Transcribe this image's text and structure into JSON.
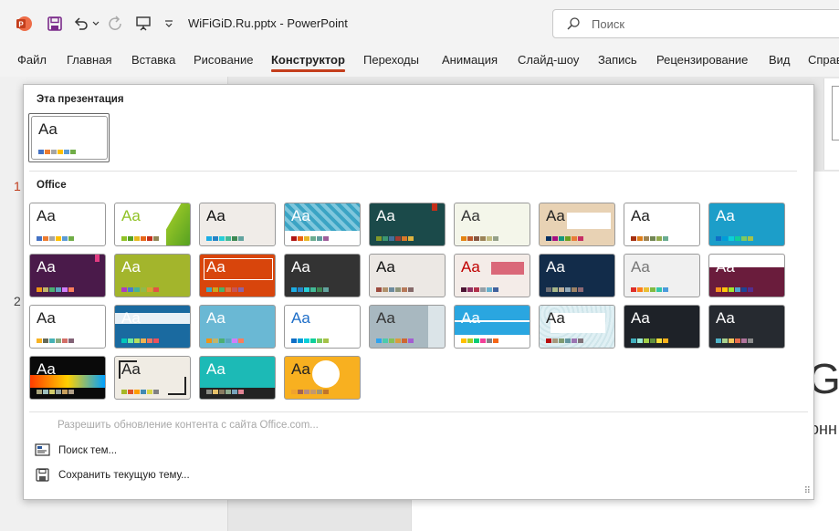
{
  "app": {
    "title": "WiFiGiD.Ru.pptx  -  PowerPoint",
    "search_placeholder": "Поиск",
    "accent": "#c43e1c"
  },
  "quick_access": {
    "icons": [
      "powerpoint-logo-icon",
      "save-icon",
      "undo-icon",
      "undo-dropdown-icon",
      "redo-icon",
      "present-icon",
      "customize-icon"
    ]
  },
  "ribbon": {
    "tabs": [
      "Файл",
      "Главная",
      "Вставка",
      "Рисование",
      "Конструктор",
      "Переходы",
      "Анимация",
      "Слайд-шоу",
      "Запись",
      "Рецензирование",
      "Вид",
      "Справ"
    ],
    "active_tab": "Конструктор"
  },
  "workspace": {
    "slide_numbers": [
      "1",
      "2"
    ],
    "main_text_1": "GiD",
    "main_text_2": "онн"
  },
  "dropdown": {
    "this_presentation_title": "Эта презентация",
    "office_title": "Office",
    "theme_sample": "Aa",
    "menu": {
      "enable_updates": "Разрешить обновление контента с сайта Office.com...",
      "browse_themes": "Поиск тем...",
      "save_theme": "Сохранить текущую тему..."
    }
  },
  "themes": [
    {
      "name": "office",
      "bg": "#ffffff",
      "fg": "#222222",
      "colors": [
        "#4472c4",
        "#ed7d31",
        "#a5a5a5",
        "#ffc000",
        "#5b9bd5",
        "#70ad47"
      ]
    },
    {
      "name": "facet",
      "bg": "#ffffff",
      "fg": "#90c226",
      "colors": [
        "#90c226",
        "#54a021",
        "#e6b91e",
        "#e76618",
        "#c42f1a",
        "#918655"
      ]
    },
    {
      "name": "integral",
      "bg": "#f0ece8",
      "fg": "#111111",
      "colors": [
        "#1cade4",
        "#2683c6",
        "#27ced7",
        "#42ba97",
        "#3e8853",
        "#62a39f"
      ]
    },
    {
      "name": "ion-boardroom",
      "bg": "#3ba4c4",
      "fg": "#ffffff",
      "colors": [
        "#b01513",
        "#ea6312",
        "#e6b729",
        "#6aac90",
        "#5f9c9d",
        "#9e5e9b"
      ]
    },
    {
      "name": "organic",
      "bg": "#1b4a4a",
      "fg": "#ffffff",
      "colors": [
        "#83992a",
        "#3c9770",
        "#44709d",
        "#a23c33",
        "#d97828",
        "#deb340"
      ]
    },
    {
      "name": "retrospect",
      "bg": "#f4f6ea",
      "fg": "#333333",
      "colors": [
        "#e48312",
        "#bd582c",
        "#865640",
        "#9b8357",
        "#c2bc80",
        "#94a088"
      ]
    },
    {
      "name": "slice",
      "bg": "#e8d2b4",
      "fg": "#222222",
      "colors": [
        "#052f61",
        "#a50e82",
        "#14967c",
        "#6a9e1f",
        "#e87d37",
        "#c62d64"
      ]
    },
    {
      "name": "wisp",
      "bg": "#ffffff",
      "fg": "#222222",
      "colors": [
        "#a53010",
        "#de7e18",
        "#9f8351",
        "#728653",
        "#92aa4c",
        "#6aac91"
      ]
    },
    {
      "name": "ion",
      "bg": "#1c9ec9",
      "fg": "#ffffff",
      "colors": [
        "#0f6fc6",
        "#009dd9",
        "#0bd0d9",
        "#10cf9b",
        "#7cca62",
        "#a5c249"
      ]
    },
    {
      "name": "berlin",
      "bg": "#4a1a4a",
      "fg": "#ffffff",
      "colors": [
        "#f09415",
        "#c1b56b",
        "#4baf73",
        "#5aa6c0",
        "#d17df9",
        "#fa7e5c"
      ]
    },
    {
      "name": "celestial",
      "bg": "#a3b52c",
      "fg": "#ffffff",
      "colors": [
        "#ac3ec1",
        "#477bd1",
        "#46b298",
        "#90ba4c",
        "#dd9d31",
        "#e25247"
      ]
    },
    {
      "name": "frame",
      "bg": "#d8450c",
      "fg": "#ffffff",
      "colors": [
        "#40a7c2",
        "#cea61b",
        "#4bb168",
        "#e2743e",
        "#c85555",
        "#8e62a3"
      ]
    },
    {
      "name": "savon",
      "bg": "#333333",
      "fg": "#ffffff",
      "colors": [
        "#1cade4",
        "#2683c6",
        "#27ced7",
        "#42ba97",
        "#3e8853",
        "#62a39f"
      ]
    },
    {
      "name": "gallery",
      "bg": "#ece8e4",
      "fg": "#111111",
      "colors": [
        "#9c4b3e",
        "#b1926c",
        "#6e8c9e",
        "#8d9479",
        "#b77a5a",
        "#866a6a"
      ]
    },
    {
      "name": "dividend",
      "bg": "#f4ece8",
      "fg": "#c00000",
      "colors": [
        "#4d1434",
        "#903163",
        "#b2324b",
        "#969fa7",
        "#66b1ce",
        "#40619d"
      ]
    },
    {
      "name": "mesh",
      "bg": "#122c4a",
      "fg": "#ffffff",
      "colors": [
        "#6f6f74",
        "#a7b789",
        "#beae98",
        "#92a9b9",
        "#9c8265",
        "#8d6974"
      ]
    },
    {
      "name": "vapor-trail",
      "bg": "#f0f0f0",
      "fg": "#777777",
      "colors": [
        "#df2e28",
        "#fe801a",
        "#e9bf35",
        "#81bb42",
        "#32c7a9",
        "#4a9bdc"
      ]
    },
    {
      "name": "parcel",
      "bg": "#6a1c3c",
      "fg": "#ffffff",
      "colors": [
        "#f7901e",
        "#fec60b",
        "#9fe62f",
        "#4ea5d1",
        "#1c4596",
        "#542d90"
      ]
    },
    {
      "name": "badge",
      "bg": "#ffffff",
      "fg": "#222222",
      "colors": [
        "#f8b323",
        "#656a59",
        "#46b2b5",
        "#8caa7e",
        "#d36f68",
        "#826276"
      ]
    },
    {
      "name": "quotable",
      "bg": "#1a6aa0",
      "fg": "#ffffff",
      "colors": [
        "#00c6bb",
        "#6feba0",
        "#b6df5e",
        "#efb251",
        "#ef755f",
        "#ed515c"
      ]
    },
    {
      "name": "basis",
      "bg": "#6ab8d4",
      "fg": "#ffffff",
      "colors": [
        "#f09415",
        "#c1b56b",
        "#4baf73",
        "#5aa6c0",
        "#d17df9",
        "#fa7e5c"
      ]
    },
    {
      "name": "circuit",
      "bg": "#ffffff",
      "fg": "#1e6ec8",
      "colors": [
        "#0f6fc6",
        "#009dd9",
        "#0bd0d9",
        "#10cf9b",
        "#7cca62",
        "#a5c249"
      ]
    },
    {
      "name": "droplet",
      "bg": "#a8b8c0",
      "fg": "#333333",
      "colors": [
        "#2fa3ee",
        "#4bcaad",
        "#86c157",
        "#d99c3f",
        "#ce6633",
        "#a35dd1"
      ]
    },
    {
      "name": "banded",
      "bg": "#ffffff",
      "fg": "#ffffff",
      "colors": [
        "#ffc000",
        "#a5d028",
        "#08cc78",
        "#f24099",
        "#828288",
        "#f56617"
      ]
    },
    {
      "name": "main-event",
      "bg": "#e0f0f4",
      "fg": "#222222",
      "colors": [
        "#b80e0f",
        "#a6987d",
        "#7f9a71",
        "#64969f",
        "#9b75b2",
        "#80737a"
      ]
    },
    {
      "name": "depth",
      "bg": "#1e2228",
      "fg": "#ffffff",
      "colors": [
        "#41aebd",
        "#97e9d5",
        "#a2cf49",
        "#608f3d",
        "#f4de3a",
        "#fcb11c"
      ]
    },
    {
      "name": "metropolitan",
      "bg": "#262a30",
      "fg": "#ffffff",
      "colors": [
        "#50b4c8",
        "#a8d08d",
        "#f2c75c",
        "#e76c4b",
        "#b0749c",
        "#8c8c8c"
      ]
    },
    {
      "name": "feathered",
      "bg": "#0a0a0a",
      "fg": "#ffffff",
      "colors": [
        "#a9a57c",
        "#9cbebd",
        "#d2cb6c",
        "#95a39d",
        "#c89f5d",
        "#b1a089"
      ]
    },
    {
      "name": "headlines",
      "bg": "#f0ece4",
      "fg": "#222222",
      "colors": [
        "#a6b727",
        "#df5327",
        "#fe9e00",
        "#418ab3",
        "#d7d447",
        "#818183"
      ]
    },
    {
      "name": "crop",
      "bg": "#1cbab6",
      "fg": "#ffffff",
      "colors": [
        "#8c8d86",
        "#e6c069",
        "#897b61",
        "#8dab8e",
        "#77a2bb",
        "#e28394"
      ]
    },
    {
      "name": "dots",
      "bg": "#f8b020",
      "fg": "#222222",
      "colors": [
        "#f0a22e",
        "#a5644e",
        "#b58b80",
        "#c3986d",
        "#a19574",
        "#c17529"
      ]
    }
  ]
}
